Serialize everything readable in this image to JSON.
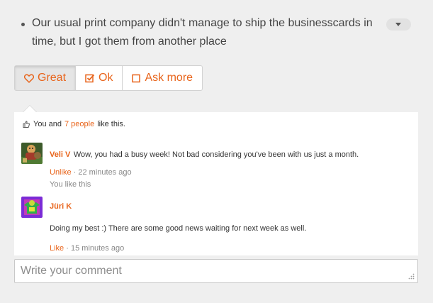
{
  "post": {
    "text": "Our usual print company didn't manage to ship the businesscards in time, but I got them from another place"
  },
  "reactions": [
    {
      "label": "Great",
      "icon": "heart-icon",
      "active": true
    },
    {
      "label": "Ok",
      "icon": "checkbox-checked-icon",
      "active": false
    },
    {
      "label": "Ask more",
      "icon": "checkbox-empty-icon",
      "active": false
    }
  ],
  "likes": {
    "prefix": "You and",
    "link": "7 people",
    "suffix": "like this."
  },
  "comments": [
    {
      "author": "Veli V",
      "text": "Wow, you had a busy week! Not bad considering you've been with us just a month.",
      "action": "Unlike",
      "separator": "·",
      "time": "22 minutes ago",
      "note": "You like this"
    },
    {
      "author": "Jüri K",
      "text": "Doing my best :) There are some good news waiting for next week as well.",
      "action": "Like",
      "separator": "·",
      "time": "15 minutes ago"
    }
  ],
  "composer": {
    "placeholder": "Write your comment"
  },
  "colors": {
    "accent": "#e8641b",
    "background": "#efefef"
  }
}
